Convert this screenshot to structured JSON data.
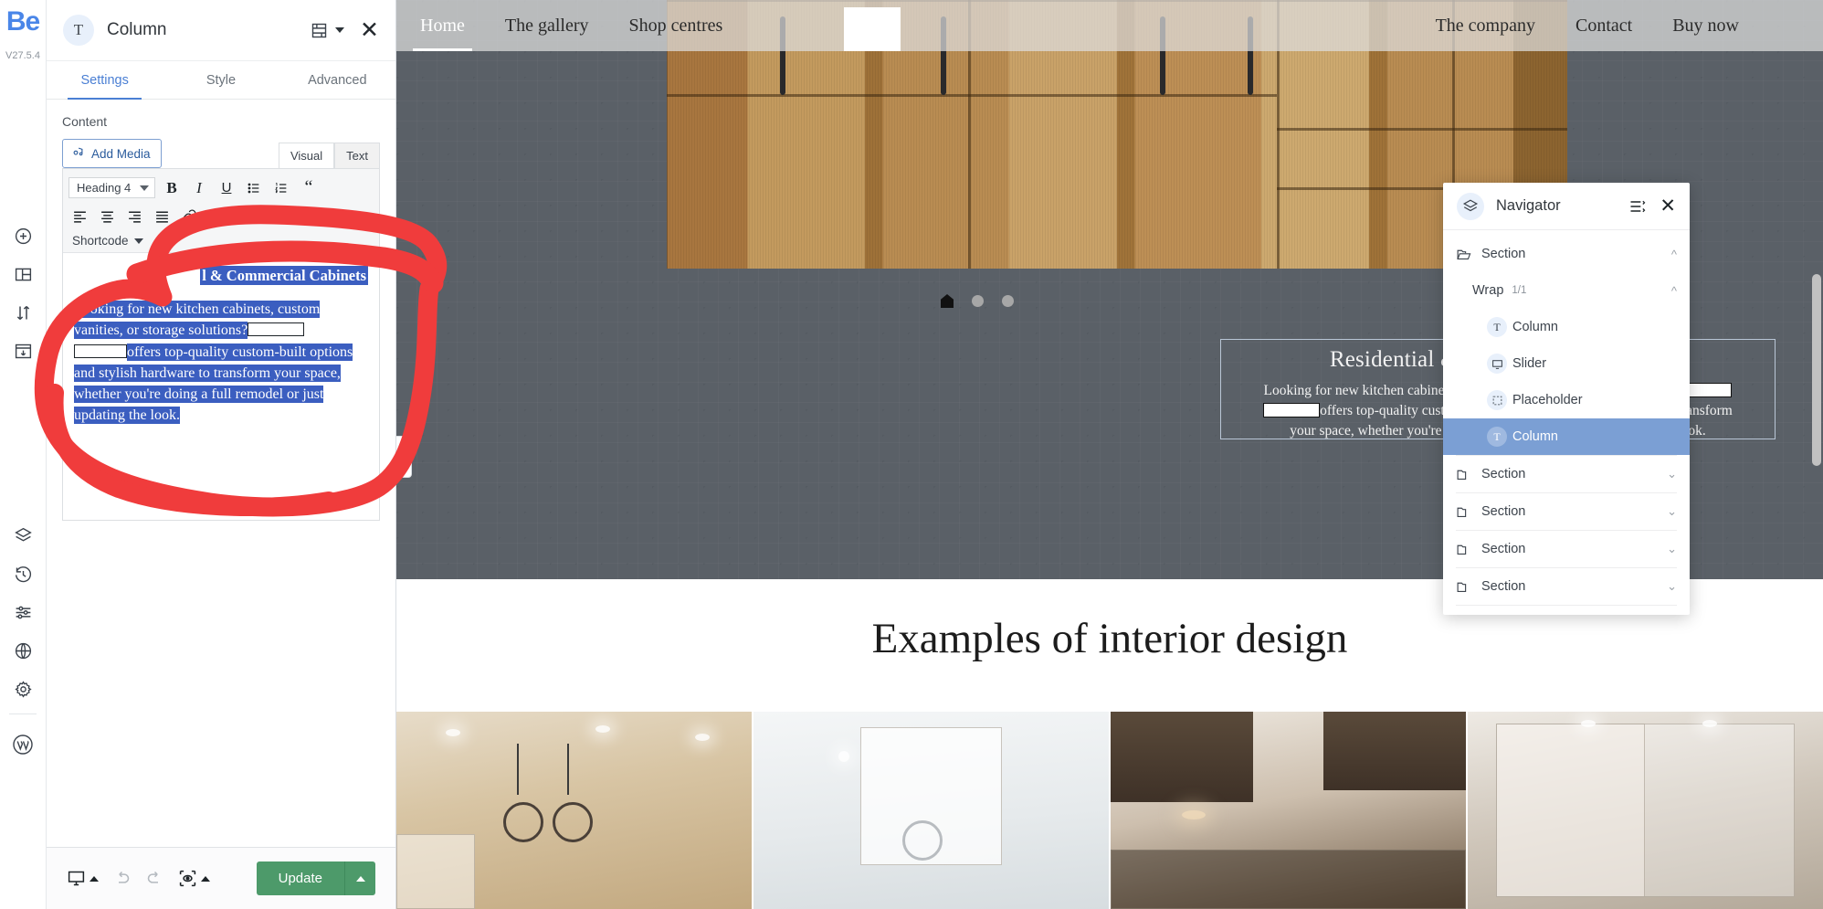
{
  "rail": {
    "logo": "Be",
    "version": "V27.5.4",
    "icons": [
      {
        "name": "add-element-icon",
        "label": "Add"
      },
      {
        "name": "layout-columns-icon",
        "label": "Layout"
      },
      {
        "name": "reorder-updown-icon",
        "label": "Reorder"
      },
      {
        "name": "save-template-icon",
        "label": "Templates"
      },
      {
        "name": "layers-icon",
        "label": "Layers"
      },
      {
        "name": "history-icon",
        "label": "History"
      },
      {
        "name": "settings-sliders-icon",
        "label": "Options"
      },
      {
        "name": "globe-icon",
        "label": "Global"
      },
      {
        "name": "gear-icon",
        "label": "Settings"
      },
      {
        "name": "wordpress-icon",
        "label": "WordPress"
      }
    ]
  },
  "sidebar": {
    "title": "Column",
    "badge_glyph": "T",
    "tabs": [
      {
        "label": "Settings",
        "active": true
      },
      {
        "label": "Style",
        "active": false
      },
      {
        "label": "Advanced",
        "active": false
      }
    ],
    "content_label": "Content",
    "add_media": "Add Media",
    "editor_mode_tabs": [
      {
        "label": "Visual",
        "active": true
      },
      {
        "label": "Text",
        "active": false
      }
    ],
    "toolbar": {
      "format_select": "Heading 4",
      "bold": "B",
      "italic": "I",
      "underline": "U",
      "bullet_list": "bulleted-list-icon",
      "numbered_list": "numbered-list-icon",
      "blockquote": "“",
      "align_left": "align-left-icon",
      "align_center": "align-center-icon",
      "align_right": "align-right-icon",
      "align_justify": "align-justify-icon",
      "link": "link-icon",
      "read_more": "insert-more-icon",
      "toolbar_toggle": "toolbar-toggle-icon",
      "shortcode": "Shortcode"
    },
    "editor_content": {
      "heading": "l & Commercial Cabinets",
      "paragraph_part1": "Looking for new kitchen cabinets, custom vanities, or storage solutions?",
      "paragraph_part2": "offers top-quality custom-built options and stylish hardware to transform your space, whether you're doing a full remodel or just updating the look."
    },
    "footer": {
      "responsive_icon": "desktop-preview-icon",
      "undo_icon": "undo-icon",
      "redo_icon": "redo-icon",
      "preview_icon": "preview-eye-icon",
      "update_label": "Update"
    },
    "collapse_handle": "‹"
  },
  "site": {
    "nav_left": [
      {
        "label": "Home",
        "active": true
      },
      {
        "label": "The gallery",
        "active": false
      },
      {
        "label": "Shop centres",
        "active": false
      }
    ],
    "nav_right": [
      {
        "label": "The company",
        "active": false
      },
      {
        "label": "Contact",
        "active": false
      },
      {
        "label": "Buy now",
        "active": false
      }
    ],
    "slider_dots": [
      "home-dot-active",
      "dot",
      "dot"
    ],
    "promo": {
      "title": "Residential & Commercial Cabinets",
      "line1": "Looking for new kitchen cabinets, custom vanities, or storage solutions?",
      "line2": "offers top-quality custom-built options and stylish hardware to transform",
      "line3": "your space, whether you're doing a full remodel or just updating the look."
    },
    "examples_title": "Examples of interior design"
  },
  "navigator": {
    "title": "Navigator",
    "badge_icon": "layers-icon",
    "options_icon": "list-options-icon",
    "close_icon": "close-icon",
    "rows": [
      {
        "label": "Section",
        "icon": "folder-open-icon",
        "indent": 1,
        "chevron": "up",
        "selected": false,
        "sub": ""
      },
      {
        "label": "Wrap",
        "icon": "",
        "indent": 2,
        "chevron": "up",
        "selected": false,
        "sub": "1/1"
      },
      {
        "label": "Column",
        "icon": "text-column-icon",
        "indent": 3,
        "chevron": "",
        "selected": false,
        "sub": ""
      },
      {
        "label": "Slider",
        "icon": "slider-monitor-icon",
        "indent": 3,
        "chevron": "",
        "selected": false,
        "sub": ""
      },
      {
        "label": "Placeholder",
        "icon": "placeholder-icon",
        "indent": 3,
        "chevron": "",
        "selected": false,
        "sub": ""
      },
      {
        "label": "Column",
        "icon": "text-column-icon",
        "indent": 3,
        "chevron": "",
        "selected": true,
        "sub": ""
      },
      {
        "label": "Section",
        "icon": "folder-icon",
        "indent": 1,
        "chevron": "down",
        "selected": false,
        "sub": ""
      },
      {
        "label": "Section",
        "icon": "folder-icon",
        "indent": 1,
        "chevron": "down",
        "selected": false,
        "sub": ""
      },
      {
        "label": "Section",
        "icon": "folder-icon",
        "indent": 1,
        "chevron": "down",
        "selected": false,
        "sub": ""
      },
      {
        "label": "Section",
        "icon": "folder-icon",
        "indent": 1,
        "chevron": "down",
        "selected": false,
        "sub": ""
      }
    ]
  },
  "annotation": {
    "name": "red-highlight-circle",
    "color": "#f03c3c"
  },
  "colors": {
    "accent_blue": "#4a7fd4",
    "selection_blue": "#3b5ec0",
    "update_green": "#4d9a6a",
    "navigator_selected": "#7b9fd4",
    "annotation_red": "#f03c3c"
  }
}
